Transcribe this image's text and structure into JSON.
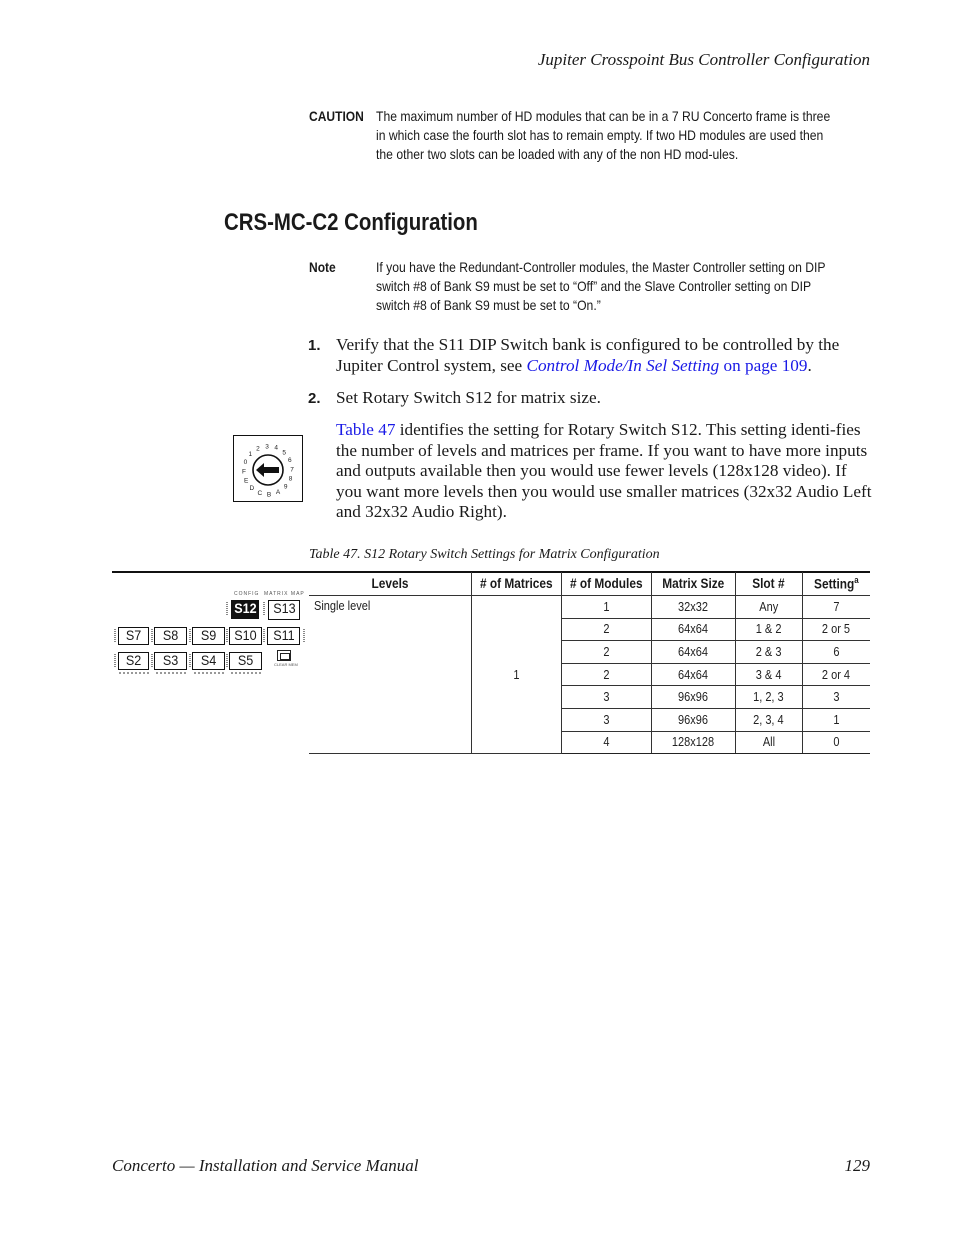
{
  "header": {
    "running_title": "Jupiter Crosspoint Bus Controller Configuration"
  },
  "caution": {
    "label": "CAUTION",
    "text": "The maximum number of HD modules that can be in a 7 RU Concerto frame is three in which case the fourth slot has to remain empty. If two HD modules are used then the other two slots can be loaded with any of the non HD mod-ules."
  },
  "section": {
    "heading": "CRS-MC-C2 Configuration"
  },
  "note": {
    "label": "Note",
    "text": "If you have the Redundant-Controller modules, the Master Controller setting on DIP switch #8 of Bank S9 must be set to “Off” and the Slave Controller setting on DIP switch #8 of Bank S9 must be set to “On.”"
  },
  "steps": [
    {
      "number": "1.",
      "text_before": "Verify that the S11 DIP Switch bank is configured to be controlled by the Jupiter Control system, see ",
      "link_title": "Control Mode/In Sel Setting",
      "link_page": " on page 109",
      "text_after": "."
    },
    {
      "number": "2.",
      "text": "Set Rotary Switch S12 for matrix size."
    }
  ],
  "intro_paragraph": {
    "link": "Table 47",
    "text": " identifies the setting for Rotary Switch S12. This setting identi-fies the number of levels and matrices per frame. If you want to have more inputs and outputs available then you would use fewer levels (128x128 video). If you want more levels then you would use smaller matrices (32x32 Audio Left and 32x32 Audio Right)."
  },
  "rotary_switch": {
    "labels": [
      "0",
      "1",
      "2",
      "3",
      "4",
      "5",
      "6",
      "7",
      "8",
      "9",
      "A",
      "B",
      "C",
      "D",
      "E",
      "F"
    ],
    "arrow_direction": "left",
    "pointed_value": "0"
  },
  "board": {
    "top_labels": [
      "CONFIG",
      "MATRIX MAP"
    ],
    "highlighted_switch": "S12",
    "switches_row1": [
      "S12",
      "S13"
    ],
    "switches_row2": [
      "S7",
      "S8",
      "S9",
      "S10",
      "S11"
    ],
    "switches_row3": [
      "S2",
      "S3",
      "S4",
      "S5"
    ],
    "button_label": "CLEAR MEM"
  },
  "table": {
    "caption": "Table 47.  S12 Rotary Switch Settings for Matrix Configuration",
    "headers": [
      "Levels",
      "# of Matrices",
      "# of Modules",
      "Matrix Size",
      "Slot #",
      "Setting"
    ],
    "setting_footnote_marker": "a",
    "levels": "Single level",
    "matrices": "1",
    "rows": [
      {
        "modules": "1",
        "matrix_size": "32x32",
        "slot": "Any",
        "setting": "7"
      },
      {
        "modules": "2",
        "matrix_size": "64x64",
        "slot": "1 & 2",
        "setting": "2 or 5"
      },
      {
        "modules": "2",
        "matrix_size": "64x64",
        "slot": "2 & 3",
        "setting": "6"
      },
      {
        "modules": "2",
        "matrix_size": "64x64",
        "slot": "3 & 4",
        "setting": "2 or 4"
      },
      {
        "modules": "3",
        "matrix_size": "96x96",
        "slot": "1, 2, 3",
        "setting": "3"
      },
      {
        "modules": "3",
        "matrix_size": "96x96",
        "slot": "2, 3, 4",
        "setting": "1"
      },
      {
        "modules": "4",
        "matrix_size": "128x128",
        "slot": "All",
        "setting": "0"
      }
    ]
  },
  "footer": {
    "manual_title": "Concerto  —  Installation and Service Manual",
    "page_number": "129"
  }
}
